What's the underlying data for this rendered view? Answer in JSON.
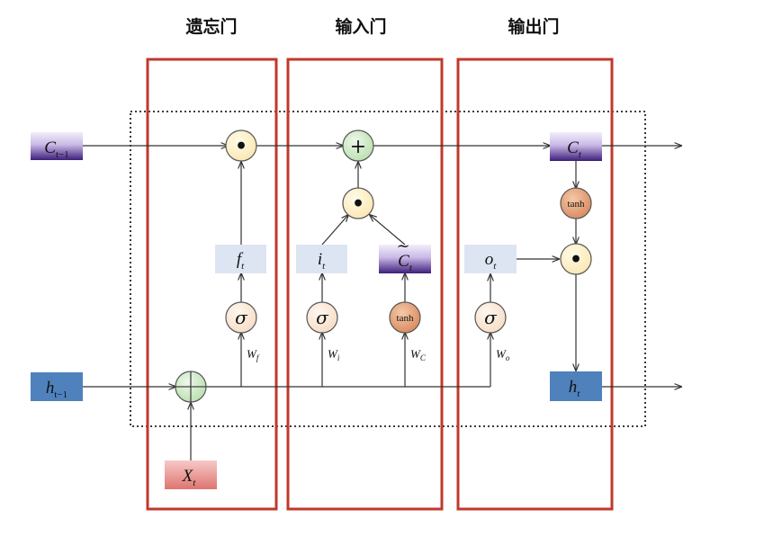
{
  "gates": {
    "forget": "遗忘门",
    "input": "输入门",
    "output": "输出门"
  },
  "labels": {
    "c_prev_main": "C",
    "c_prev_sub": "t−1",
    "h_prev_main": "h",
    "h_prev_sub": "t−1",
    "x_main": "X",
    "x_sub": "t",
    "f_main": "f",
    "f_sub": "t",
    "i_main": "i",
    "i_sub": "t",
    "ct_main": "C",
    "ct_sub": "t",
    "ct_tilde": "~",
    "o_main": "o",
    "o_sub": "t",
    "c_out_main": "C",
    "c_out_sub": "t",
    "h_out_main": "h",
    "h_out_sub": "t",
    "wf_main": "W",
    "wf_sub": "f",
    "wi_main": "W",
    "wi_sub": "i",
    "wc_main": "W",
    "wc_sub": "C",
    "wo_main": "W",
    "wo_sub": "o"
  },
  "ops": {
    "mult": "•",
    "add": "+",
    "sigma": "σ",
    "tanh": "tanh"
  },
  "colors": {
    "gate_border": "#c0392b",
    "cell_state": "#5b3a96",
    "hidden": "#4f81bd",
    "input_x": "#e3817e",
    "gate_value": "#dde5f2",
    "mult_node": "#fff5d6",
    "add_node": "#d4edd0",
    "tanh_node": "#e2a07a",
    "sigma_node": "#fdeee0"
  }
}
